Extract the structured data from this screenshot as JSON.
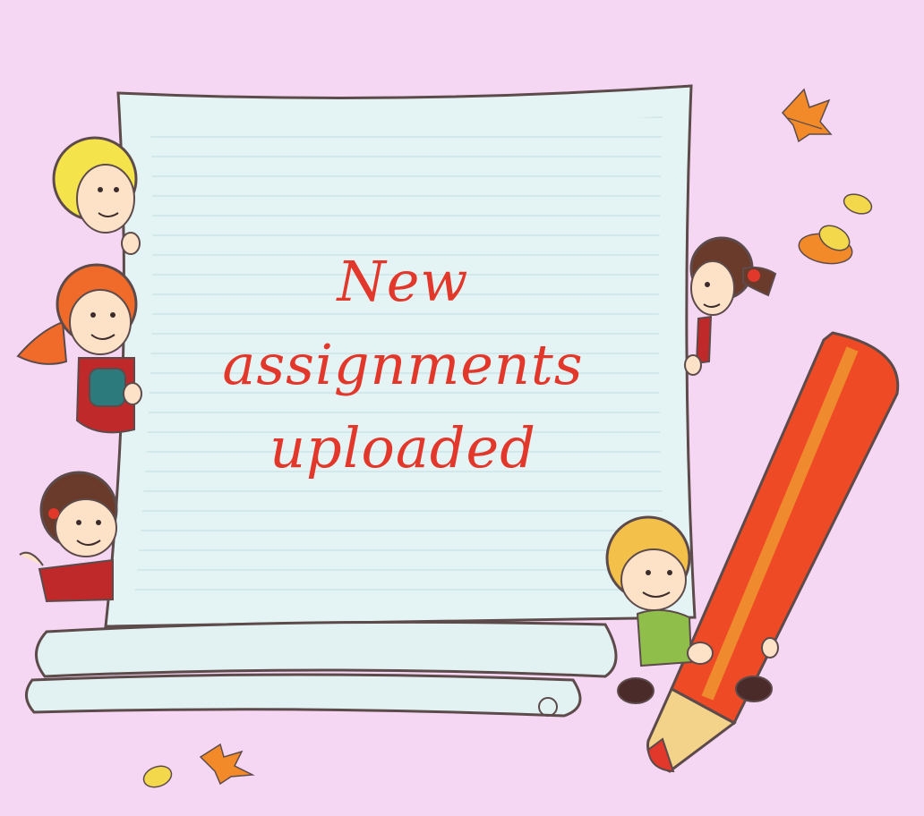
{
  "message": {
    "line1": "New",
    "line2": "assignments",
    "line3": "uploaded"
  },
  "colors": {
    "background": "#f6d7f3",
    "paper": "#e4f4f4",
    "paper_edge": "#5d4b4b",
    "text": "#e2382c",
    "pencil": "#ee4a25",
    "leaf_orange": "#f28a2a",
    "leaf_yellow": "#f2d84a"
  }
}
